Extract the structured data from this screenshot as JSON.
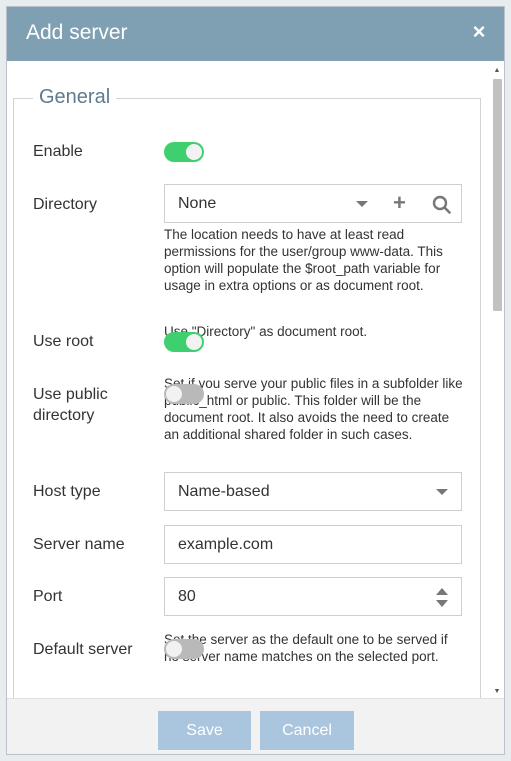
{
  "dialog": {
    "title": "Add server",
    "close_label": "×"
  },
  "general": {
    "legend": "General",
    "enable": {
      "label": "Enable",
      "on": true
    },
    "directory": {
      "label": "Directory",
      "value": "None",
      "help": "The location needs to have at least read permissions for the user/group www-data. This option will populate the $root_path variable for usage in extra options or as document root."
    },
    "use_root": {
      "label": "Use root",
      "on": true,
      "help": "Use \"Directory\" as document root."
    },
    "use_public_directory": {
      "label": "Use public directory",
      "on": false,
      "help": "Set if you serve your public files in a subfolder like public_html or public. This folder will be the document root. It also avoids the need to create an additional shared folder in such cases."
    },
    "host_type": {
      "label": "Host type",
      "value": "Name-based"
    },
    "server_name": {
      "label": "Server name",
      "value": "example.com"
    },
    "port": {
      "label": "Port",
      "value": "80"
    },
    "default_server": {
      "label": "Default server",
      "on": false,
      "help": "Set the server as the default one to be served if no server name matches on the selected port."
    }
  },
  "footer": {
    "save_label": "Save",
    "cancel_label": "Cancel"
  },
  "colors": {
    "titlebar": "#7f9fb3",
    "toggle_on": "#3ed06f",
    "toggle_off": "#b9b9b9",
    "button": "#a9c6de",
    "legend": "#5e7b8f"
  },
  "icons": [
    "close-icon",
    "caret-down-icon",
    "plus-icon",
    "search-icon",
    "spinner-up-icon",
    "spinner-down-icon"
  ]
}
